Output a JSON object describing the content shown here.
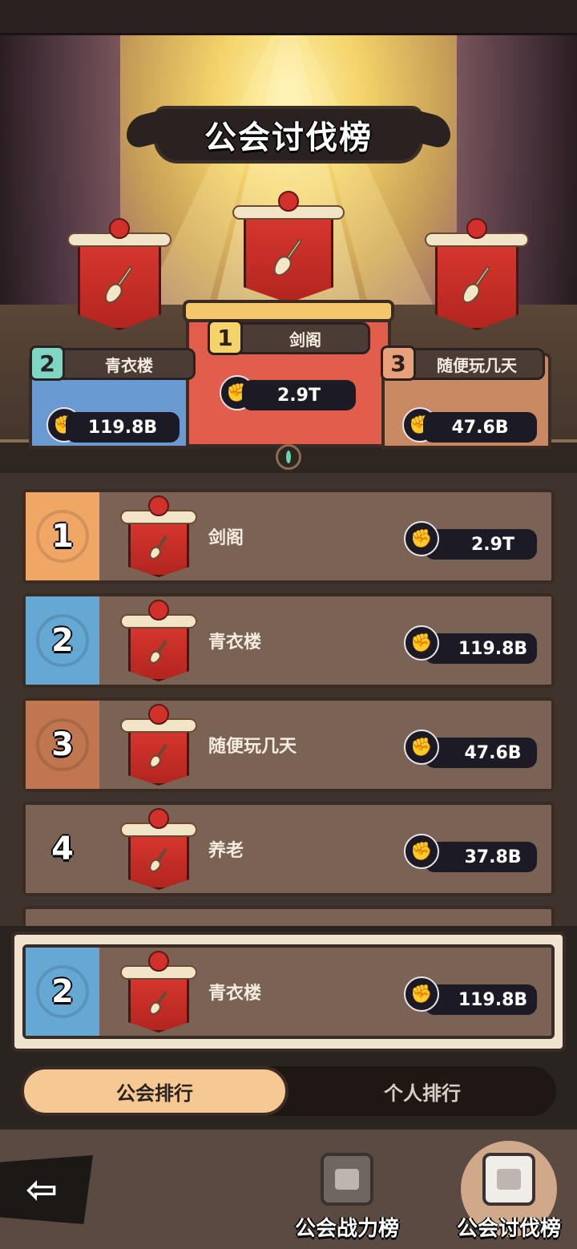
{
  "title": "公会讨伐榜",
  "podium": [
    {
      "rank": "1",
      "name": "剑阁",
      "power": "2.9T"
    },
    {
      "rank": "2",
      "name": "青衣楼",
      "power": "119.8B"
    },
    {
      "rank": "3",
      "name": "随便玩几天",
      "power": "47.6B"
    }
  ],
  "list": [
    {
      "rank": "1",
      "name": "剑阁",
      "power": "2.9T"
    },
    {
      "rank": "2",
      "name": "青衣楼",
      "power": "119.8B"
    },
    {
      "rank": "3",
      "name": "随便玩几天",
      "power": "47.6B"
    },
    {
      "rank": "4",
      "name": "养老",
      "power": "37.8B"
    }
  ],
  "own": {
    "rank": "2",
    "name": "青衣楼",
    "power": "119.8B"
  },
  "tabs": {
    "guild": "公会排行",
    "person": "个人排行"
  },
  "nav": {
    "power": "公会战力榜",
    "raid": "公会讨伐榜",
    "back_icon": "back-arrow-icon"
  },
  "colors": {
    "rank1": "#f0a766",
    "rank2": "#66a8d4",
    "rank3": "#c0774f",
    "accent": "#f6c893"
  }
}
